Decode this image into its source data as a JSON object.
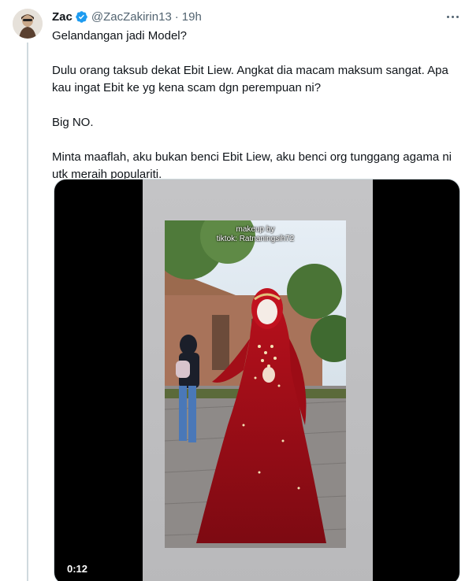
{
  "author": {
    "name": "Zac",
    "handle": "@ZacZakirin13",
    "separator": "·",
    "time": "19h"
  },
  "tweet": {
    "paragraphs": [
      "Gelandangan jadi Model?",
      "Dulu orang taksub dekat Ebit Liew. Angkat dia macam maksum sangat. Apa kau ingat Ebit ke yg kena scam dgn perempuan ni?",
      "Big NO.",
      "Minta maaflah, aku bukan benci Ebit Liew, aku benci org tunggang agama ni utk meraih populariti."
    ]
  },
  "media": {
    "duration": "0:12",
    "watermark_line1": "makeup by",
    "watermark_line2": "tiktok: Ratnaningsih72"
  },
  "colors": {
    "verified": "#1d9bf0",
    "muted": "#536471",
    "text": "#0f1419"
  },
  "icons": {
    "verified": "verified-badge-icon",
    "more": "more-horizontal-icon"
  }
}
